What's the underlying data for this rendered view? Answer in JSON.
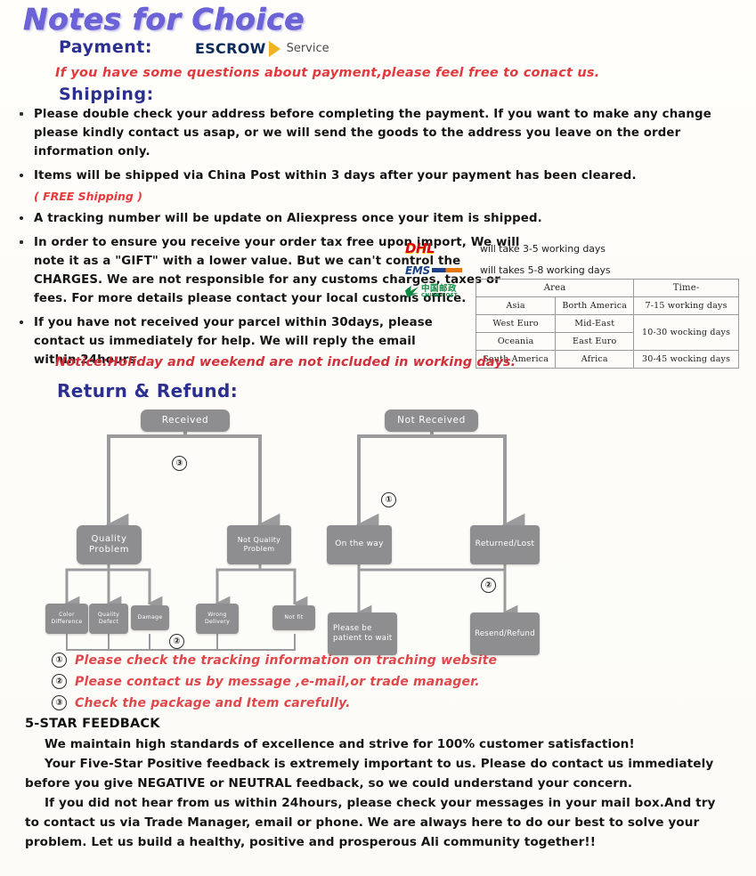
{
  "header": {
    "title": "Notes for Choice",
    "payment_label": "Payment:",
    "escrow_word": "ESCROW",
    "escrow_service": "Service",
    "payment_note": "If you have some questions about payment,please feel free to conact us.",
    "shipping_label": "Shipping:"
  },
  "shipping_bullets": [
    "Please double check your address before completing the payment. If you want to make any change please kindly contact us asap, or we will send the goods to the address you leave on the order information only.",
    "Items will be shipped via China Post within 3 days after your payment has been cleared.",
    "A tracking number will be update on Aliexpress once your item is shipped.",
    "In order to ensure you receive your order tax free upon import, We will note it as a \"GIFT\" with a lower value. But we can't control the CHARGES. We are not responsible for any customs charges, taxes or fees. For more details please contact your local customs office.",
    "If you have not received your parcel within 30days, please contact us immediately for help. We will reply the email within 24hours."
  ],
  "free_shipping_note": "( FREE Shipping )",
  "couriers": [
    {
      "logo": "dhl-logo",
      "name": "DHL",
      "time": "will take 3-5 working days"
    },
    {
      "logo": "ems-logo",
      "name": "EMS",
      "time": "will takes 5-8 working days"
    },
    {
      "logo": "china-post-logo",
      "name": "CHINA POST",
      "cn": "中国邮政",
      "en": "CHINA POST",
      "time": ""
    }
  ],
  "ship_table": {
    "headers": [
      "Area",
      "Time-"
    ],
    "rows": [
      {
        "area1": "Asia",
        "area2": "Borth America",
        "time": "7-15 working days"
      },
      {
        "area1": "West Euro",
        "area2": "Mid-East",
        "time": "10-30 wocking days"
      },
      {
        "area1": "Oceania",
        "area2": "East Euro",
        "time": ""
      },
      {
        "area1": "South America",
        "area2": "Africa",
        "time": "30-45 wocking days"
      }
    ]
  },
  "notice": "Notice:Holiday and weekend are not included in working days.",
  "return_title": "Return & Refund:",
  "flowchart": {
    "nodes": {
      "received": "Received",
      "not_received": "Not Received",
      "quality_problem": "Quality Problem",
      "not_quality_problem": "Not Quality Problem",
      "on_the_way": "On the way",
      "returned_lost": "Returned/Lost",
      "color_difference": "Color Difference",
      "quality_defect": "Quality Defect",
      "damage": "Damage",
      "wrong_delivery": "Wrong Delivery",
      "not_fit": "Not fit",
      "please_be_patient": "Please be patient to wait",
      "resend_refund": "Resend/Refund"
    },
    "markers": {
      "m3": "③",
      "m1": "①",
      "m2a": "②",
      "m2b": "②"
    }
  },
  "legend": [
    {
      "num": "①",
      "text": "Please check the tracking information on traching website"
    },
    {
      "num": "②",
      "text": "Please contact us by message ,e-mail,or trade manager."
    },
    {
      "num": "③",
      "text": "Check the package and Item carefully."
    }
  ],
  "feedback": {
    "title": "5-STAR FEEDBACK",
    "paragraphs": [
      "We maintain high standards of excellence and strive for 100% customer satisfaction!",
      "Your Five-Star Positive feedback is extremely important to us. Please do contact us immediately before you give NEGATIVE or NEUTRAL feedback, so we could understand your concern.",
      "If you did not hear from us within 24hours, please check your messages in your mail box.And try to contact us via Trade Manager, email or phone. We are always here to do our best to solve your problem. Let us build a healthy, positive and prosperous Ali community together!!"
    ]
  },
  "colors": {
    "title_purple": "#6c63d8",
    "heading_blue": "#2b2f8f",
    "alert_red": "#e03a3e",
    "flow_gray": "#8e8e90"
  }
}
